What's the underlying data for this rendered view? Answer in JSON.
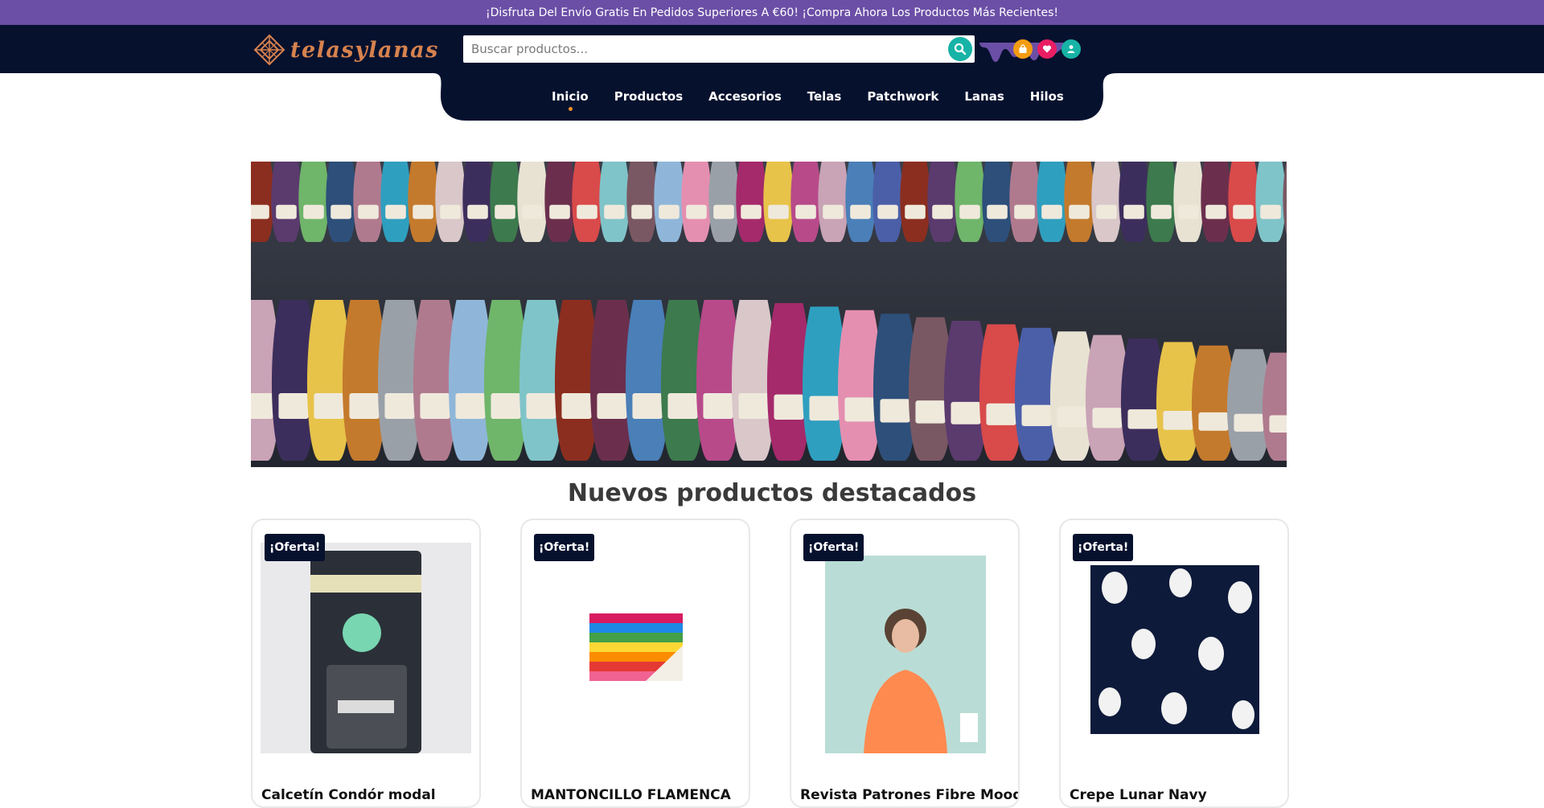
{
  "promo": {
    "text": "¡Disfruta Del Envío Gratis En Pedidos Superiores A €60! ¡Compra Ahora Los Productos Más Recientes!"
  },
  "header": {
    "logo_text": "telasylanas",
    "search_placeholder": "Buscar productos...",
    "icons": [
      "shopping-bag-icon",
      "heart-icon",
      "user-icon"
    ],
    "icon_colors": {
      "cart": "#f39c12",
      "wishlist": "#e91e63",
      "account": "#16b3a6"
    }
  },
  "nav": {
    "items": [
      {
        "label": "Inicio",
        "active": true
      },
      {
        "label": "Productos"
      },
      {
        "label": "Accesorios"
      },
      {
        "label": "Telas"
      },
      {
        "label": "Patchwork"
      },
      {
        "label": "Lanas"
      },
      {
        "label": "Hilos"
      }
    ]
  },
  "hero": {
    "alt": "Madejas de lana de colores en estantería"
  },
  "featured": {
    "title": "Nuevos productos destacados",
    "products": [
      {
        "badge": "¡Oferta!",
        "name": "Calcetín Condór modal"
      },
      {
        "badge": "¡Oferta!",
        "name": "MANTONCILLO FLAMENCA"
      },
      {
        "badge": "¡Oferta!",
        "name": "Revista Patrones Fibre Mood"
      },
      {
        "badge": "¡Oferta!",
        "name": "Crepe Lunar Navy"
      }
    ]
  },
  "colors": {
    "promo_bg": "#6b4fa6",
    "header_bg": "#06112e",
    "accent_orange": "#f0932b",
    "logo": "#d7824e"
  }
}
